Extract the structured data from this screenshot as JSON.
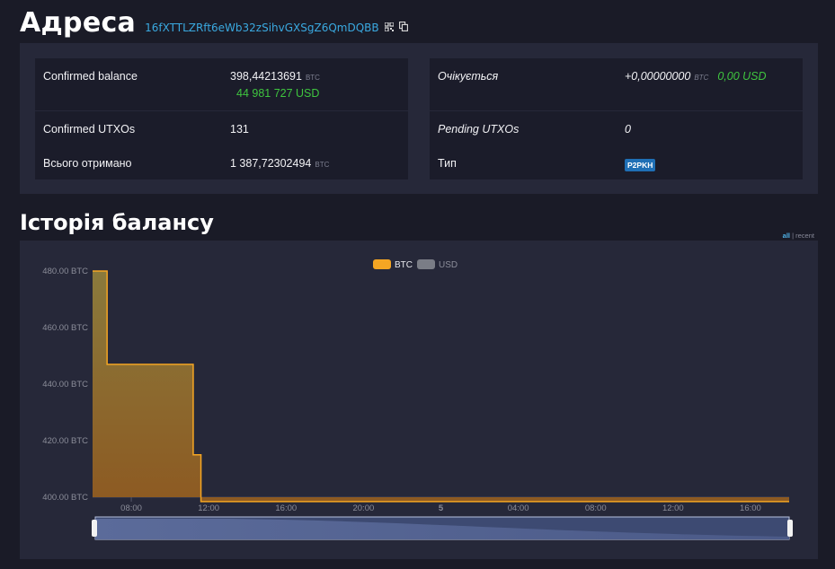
{
  "header": {
    "title": "Адреса",
    "address": "16fXTTLZRft6eWb32zSihvGXSgZ6QmDQBB",
    "qr_icon": "qr-code-icon",
    "copy_icon": "copy-icon"
  },
  "summary": {
    "confirmed_balance": {
      "label": "Confirmed balance",
      "value": "398,44213691",
      "unit": "BTC",
      "fiat": "44 981 727 USD"
    },
    "expected": {
      "label": "Очікується",
      "value": "+0,00000000",
      "unit": "BTC",
      "fiat": "0,00 USD"
    },
    "confirmed_utxos": {
      "label": "Confirmed UTXOs",
      "value": "131"
    },
    "pending_utxos": {
      "label": "Pending UTXOs",
      "value": "0"
    },
    "total_received": {
      "label": "Всього отримано",
      "value": "1 387,72302494",
      "unit": "BTC"
    },
    "type": {
      "label": "Тип",
      "value": "P2PKH"
    }
  },
  "history": {
    "title": "Історія балансу",
    "range_all": "all",
    "range_sep": "|",
    "range_recent": "recent"
  },
  "colors": {
    "btc": "#f5a623",
    "usd": "#7a7d86",
    "accent": "#3aa9e0",
    "green": "#3fc53f"
  },
  "chart_data": {
    "type": "area",
    "series": [
      {
        "name": "BTC",
        "step": true,
        "points": [
          {
            "x": 6.0,
            "y": 480
          },
          {
            "x": 6.75,
            "y": 447
          },
          {
            "x": 11.2,
            "y": 415
          },
          {
            "x": 11.6,
            "y": 398.44
          },
          {
            "x": 41.0,
            "y": 398.44
          }
        ]
      }
    ],
    "legend": [
      "BTC",
      "USD"
    ],
    "legend_position": "top-center",
    "x_ticks": [
      "08:00",
      "12:00",
      "16:00",
      "20:00",
      "5",
      "04:00",
      "08:00",
      "12:00",
      "16:00"
    ],
    "y_ticks": [
      "400.00 BTC",
      "420.00 BTC",
      "440.00 BTC",
      "460.00 BTC",
      "480.00 BTC"
    ],
    "ylim": [
      400,
      480
    ],
    "xlim": [
      6,
      42
    ],
    "grid": false
  }
}
